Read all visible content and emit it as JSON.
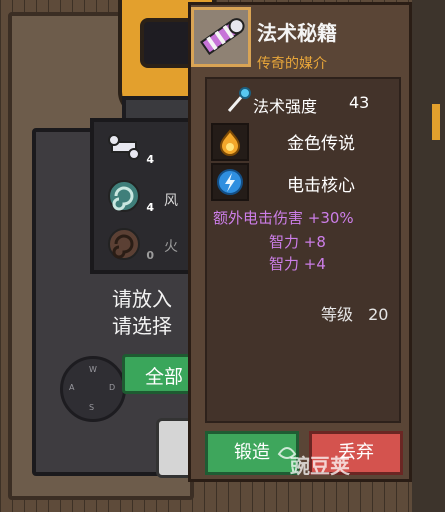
{
  "background": {
    "slot_counts": [
      "4",
      "4",
      "0"
    ],
    "slot_labels": [
      "风",
      "火"
    ],
    "place_prompt": [
      "请放入",
      "请选择"
    ],
    "all_button_label": "全部",
    "joystick_letters": [
      "W",
      "A",
      "D",
      "S"
    ]
  },
  "tooltip": {
    "title": "法术秘籍",
    "subtitle": "传奇的媒介",
    "spell_power_label": "法术强度",
    "spell_power_value": "43",
    "perks": [
      {
        "label": "金色传说",
        "icon": "fire-orb-icon"
      },
      {
        "label": "电击核心",
        "icon": "lightning-orb-icon"
      }
    ],
    "bonuses": [
      "额外电击伤害 +30%",
      "智力 +8",
      "智力 +4"
    ],
    "level_label": "等级",
    "level_value": "20",
    "forge_label": "锻造",
    "discard_label": "丢弃"
  },
  "watermark": "豌豆荚",
  "colors": {
    "accent_gold": "#e8a63a",
    "bonus_purple": "#cc7ee8",
    "forge_green": "#3ea65c",
    "discard_red": "#d4534e"
  }
}
